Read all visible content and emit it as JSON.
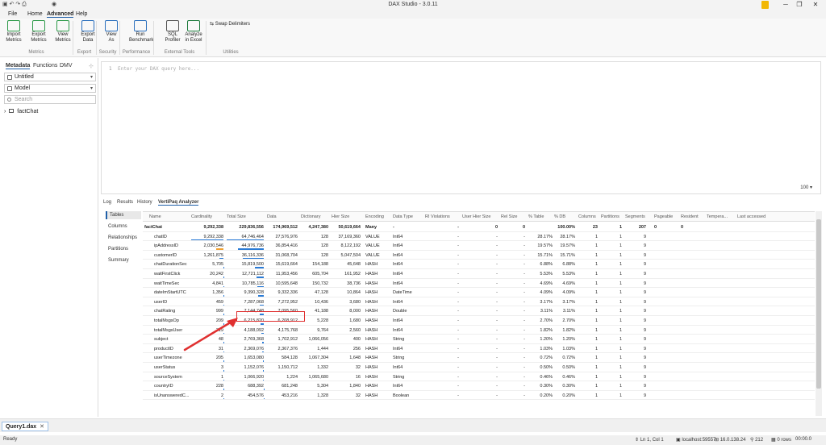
{
  "window": {
    "title": "DAX Studio - 3.0.11",
    "minimize": "─",
    "maximize": "❐",
    "close": "✕"
  },
  "menu": [
    "File",
    "Home",
    "Advanced",
    "Help"
  ],
  "ribbon": {
    "buttons": [
      {
        "label": "Import\nMetrics",
        "icon": "import-metrics-icon",
        "color": "#2e9a4a"
      },
      {
        "label": "Export\nMetrics",
        "icon": "export-metrics-icon",
        "color": "#2e9a4a"
      },
      {
        "label": "View\nMetrics",
        "icon": "view-metrics-icon",
        "color": "#2e9a4a"
      },
      {
        "label": "Export\nData",
        "icon": "export-data-icon",
        "color": "#2a6fbd"
      },
      {
        "label": "View\nAs",
        "icon": "view-as-icon",
        "color": "#2a6fbd"
      },
      {
        "label": "Run\nBenchmark",
        "icon": "run-benchmark-icon",
        "color": "#2a6fbd"
      },
      {
        "label": "SQL\nProfiler",
        "icon": "sql-profiler-icon",
        "color": "#555555"
      },
      {
        "label": "Analyze\nin Excel",
        "icon": "excel-icon",
        "color": "#1d7a3c"
      }
    ],
    "swap": "Swap Delimiters",
    "groups": [
      "Metrics",
      "Export",
      "Security",
      "Performance",
      "External Tools",
      "Utilities"
    ]
  },
  "leftpane": {
    "tabs": [
      "Metadata",
      "Functions",
      "DMV"
    ],
    "database": "Untitled",
    "model": "Model",
    "search_placeholder": "Search",
    "tree_item": "factChat"
  },
  "editor": {
    "line": "1",
    "placeholder": "Enter your DAX query here...",
    "zoom": "100"
  },
  "output_tabs": [
    "Log",
    "Results",
    "History",
    "VertiPaq Analyzer"
  ],
  "sidenav": [
    "Tables",
    "Columns",
    "Relationships",
    "Partitions",
    "Summary"
  ],
  "grid": {
    "headers": [
      "Name",
      "Cardinality",
      "Total Size",
      "Data",
      "Dictionary",
      "Hier Size",
      "Encoding",
      "Data Type",
      "RI Violations",
      "User Hier Size",
      "Rel Size",
      "% Table",
      "% DB",
      "Columns",
      "Partitions",
      "Segments",
      "Pageable",
      "Resident",
      "Tempera...",
      "Last accessed"
    ],
    "total": [
      "factChat",
      "9,292,338",
      "229,836,556",
      "174,969,512",
      "4,247,380",
      "50,619,664",
      "Many",
      "-",
      "-",
      "0",
      "0",
      "",
      "100.00%",
      "23",
      "1",
      "207",
      "0",
      "0",
      "",
      ""
    ],
    "rows": [
      [
        "chatID",
        "9,292,338",
        "64,746,464",
        "27,576,976",
        "128",
        "37,169,360",
        "VALUE",
        "Int64",
        "-",
        "-",
        "-",
        "28.17%",
        "28.17%",
        "1",
        "1",
        "9",
        "",
        "",
        "",
        ""
      ],
      [
        "ipAddressID",
        "2,030,546",
        "44,976,736",
        "36,854,416",
        "128",
        "8,122,192",
        "VALUE",
        "Int64",
        "-",
        "-",
        "-",
        "19.57%",
        "19.57%",
        "1",
        "1",
        "9",
        "",
        "",
        "",
        ""
      ],
      [
        "customerID",
        "1,261,875",
        "36,116,336",
        "31,068,704",
        "128",
        "5,047,504",
        "VALUE",
        "Int64",
        "-",
        "-",
        "-",
        "15.71%",
        "15.71%",
        "1",
        "1",
        "9",
        "",
        "",
        "",
        ""
      ],
      [
        "chatDurationSec",
        "5,705",
        "15,819,500",
        "15,619,664",
        "154,188",
        "45,648",
        "HASH",
        "Int64",
        "-",
        "-",
        "-",
        "6.88%",
        "6.88%",
        "1",
        "1",
        "9",
        "",
        "",
        "",
        ""
      ],
      [
        "waitFirstClick",
        "20,242",
        "12,721,112",
        "11,953,456",
        "605,704",
        "161,952",
        "HASH",
        "Int64",
        "-",
        "-",
        "-",
        "5.53%",
        "5.53%",
        "1",
        "1",
        "9",
        "",
        "",
        "",
        ""
      ],
      [
        "waitTimeSec",
        "4,841",
        "10,785,116",
        "10,595,648",
        "150,732",
        "38,736",
        "HASH",
        "Int64",
        "-",
        "-",
        "-",
        "4.69%",
        "4.69%",
        "1",
        "1",
        "9",
        "",
        "",
        "",
        ""
      ],
      [
        "dateImStartUTC",
        "1,356",
        "9,390,328",
        "9,332,336",
        "47,128",
        "10,864",
        "HASH",
        "DateTime",
        "-",
        "-",
        "-",
        "4.09%",
        "4.09%",
        "1",
        "1",
        "9",
        "",
        "",
        "",
        ""
      ],
      [
        "userID",
        "459",
        "7,287,068",
        "7,272,952",
        "10,436",
        "3,680",
        "HASH",
        "Int64",
        "-",
        "-",
        "-",
        "3.17%",
        "3.17%",
        "1",
        "1",
        "9",
        "",
        "",
        "",
        ""
      ],
      [
        "chatRating",
        "999",
        "7,144,748",
        "7,095,560",
        "41,188",
        "8,000",
        "HASH",
        "Double",
        "-",
        "-",
        "-",
        "3.11%",
        "3.11%",
        "1",
        "1",
        "9",
        "",
        "",
        "",
        ""
      ],
      [
        "totalMsgsOp",
        "209",
        "6,215,820",
        "6,208,912",
        "5,228",
        "1,680",
        "HASH",
        "Int64",
        "-",
        "-",
        "-",
        "2.70%",
        "2.70%",
        "1",
        "1",
        "9",
        "",
        "",
        "",
        ""
      ],
      [
        "totalMsgsUser",
        "319",
        "4,188,092",
        "4,175,768",
        "9,764",
        "2,560",
        "HASH",
        "Int64",
        "-",
        "-",
        "-",
        "1.82%",
        "1.82%",
        "1",
        "1",
        "9",
        "",
        "",
        "",
        ""
      ],
      [
        "subject",
        "48",
        "2,769,368",
        "1,702,912",
        "1,066,056",
        "400",
        "HASH",
        "String",
        "-",
        "-",
        "-",
        "1.20%",
        "1.20%",
        "1",
        "1",
        "9",
        "",
        "",
        "",
        ""
      ],
      [
        "productID",
        "31",
        "2,369,076",
        "2,367,376",
        "1,444",
        "256",
        "HASH",
        "Int64",
        "-",
        "-",
        "-",
        "1.03%",
        "1.03%",
        "1",
        "1",
        "9",
        "",
        "",
        "",
        ""
      ],
      [
        "userTimezone",
        "205",
        "1,653,080",
        "584,128",
        "1,067,304",
        "1,648",
        "HASH",
        "String",
        "-",
        "-",
        "-",
        "0.72%",
        "0.72%",
        "1",
        "1",
        "9",
        "",
        "",
        "",
        ""
      ],
      [
        "userStatus",
        "3",
        "1,152,076",
        "1,150,712",
        "1,332",
        "32",
        "HASH",
        "Int64",
        "-",
        "-",
        "-",
        "0.50%",
        "0.50%",
        "1",
        "1",
        "9",
        "",
        "",
        "",
        ""
      ],
      [
        "sourceSystem",
        "1",
        "1,066,920",
        "1,224",
        "1,065,680",
        "16",
        "HASH",
        "String",
        "-",
        "-",
        "-",
        "0.46%",
        "0.46%",
        "1",
        "1",
        "9",
        "",
        "",
        "",
        ""
      ],
      [
        "countryID",
        "228",
        "688,392",
        "681,248",
        "5,304",
        "1,840",
        "HASH",
        "Int64",
        "-",
        "-",
        "-",
        "0.30%",
        "0.30%",
        "1",
        "1",
        "9",
        "",
        "",
        "",
        ""
      ],
      [
        "isUnansweredC...",
        "2",
        "454,576",
        "453,216",
        "1,328",
        "32",
        "HASH",
        "Boolean",
        "-",
        "-",
        "-",
        "0.20%",
        "0.20%",
        "1",
        "1",
        "9",
        "",
        "",
        "",
        ""
      ]
    ]
  },
  "doc_tab": {
    "label": "Query1.dax",
    "close": "✕"
  },
  "status": {
    "ready": "Ready",
    "position": "Ln 1, Col 1",
    "server": "localhost:59557",
    "version": "16.0.138.24",
    "spid": "212",
    "rows": "0 rows",
    "time": "00:00.0"
  },
  "colors": {
    "accent": "#1f5fa8",
    "highlight": "#e03030",
    "bar": "#2a7bd6",
    "bar_warn": "#f0a030"
  }
}
